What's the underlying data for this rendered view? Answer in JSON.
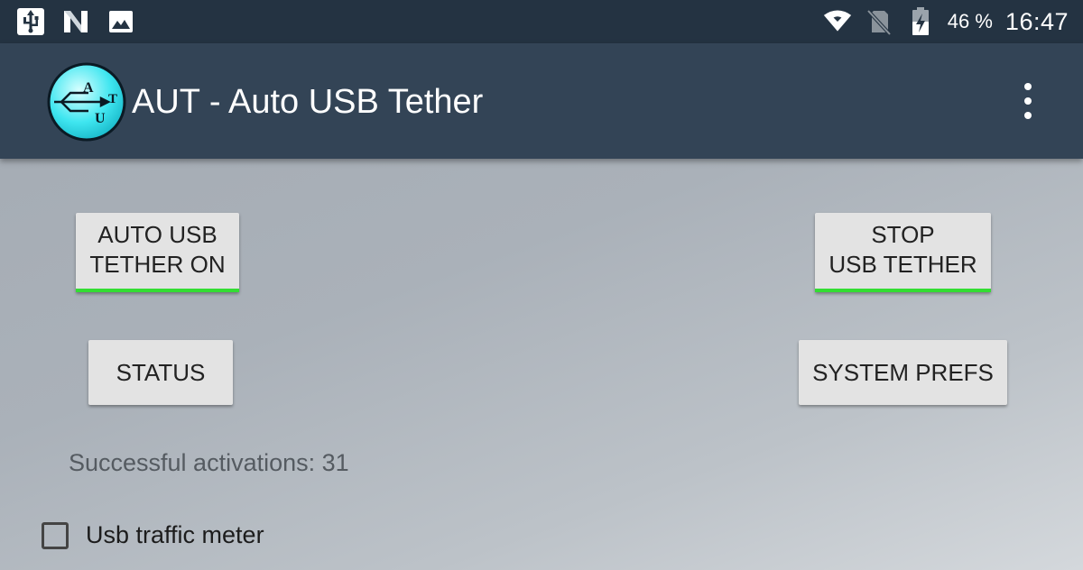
{
  "status_bar": {
    "icons_left": [
      "usb-icon",
      "n-notification-icon",
      "image-icon"
    ],
    "icons_right": [
      "wifi-icon",
      "no-sim-icon",
      "battery-charging-icon"
    ],
    "battery_percent": "46 %",
    "time": "16:47"
  },
  "app_bar": {
    "logo_letters": [
      "A",
      "T",
      "U"
    ],
    "title": "AUT - Auto USB Tether",
    "menu_icon": "overflow-menu-icon"
  },
  "buttons": {
    "auto_tether": "AUTO USB\nTETHER ON",
    "stop_tether": "STOP\nUSB TETHER",
    "status": "STATUS",
    "system_prefs": "SYSTEM PREFS"
  },
  "activations": {
    "label": "Successful activations: 31"
  },
  "traffic_meter": {
    "label": "Usb traffic meter",
    "checked": false
  },
  "colors": {
    "status_bar_bg": "#243342",
    "app_bar_bg": "#334456",
    "indicator_green": "#33dd33",
    "logo_cyan": "#3fe6f0"
  }
}
